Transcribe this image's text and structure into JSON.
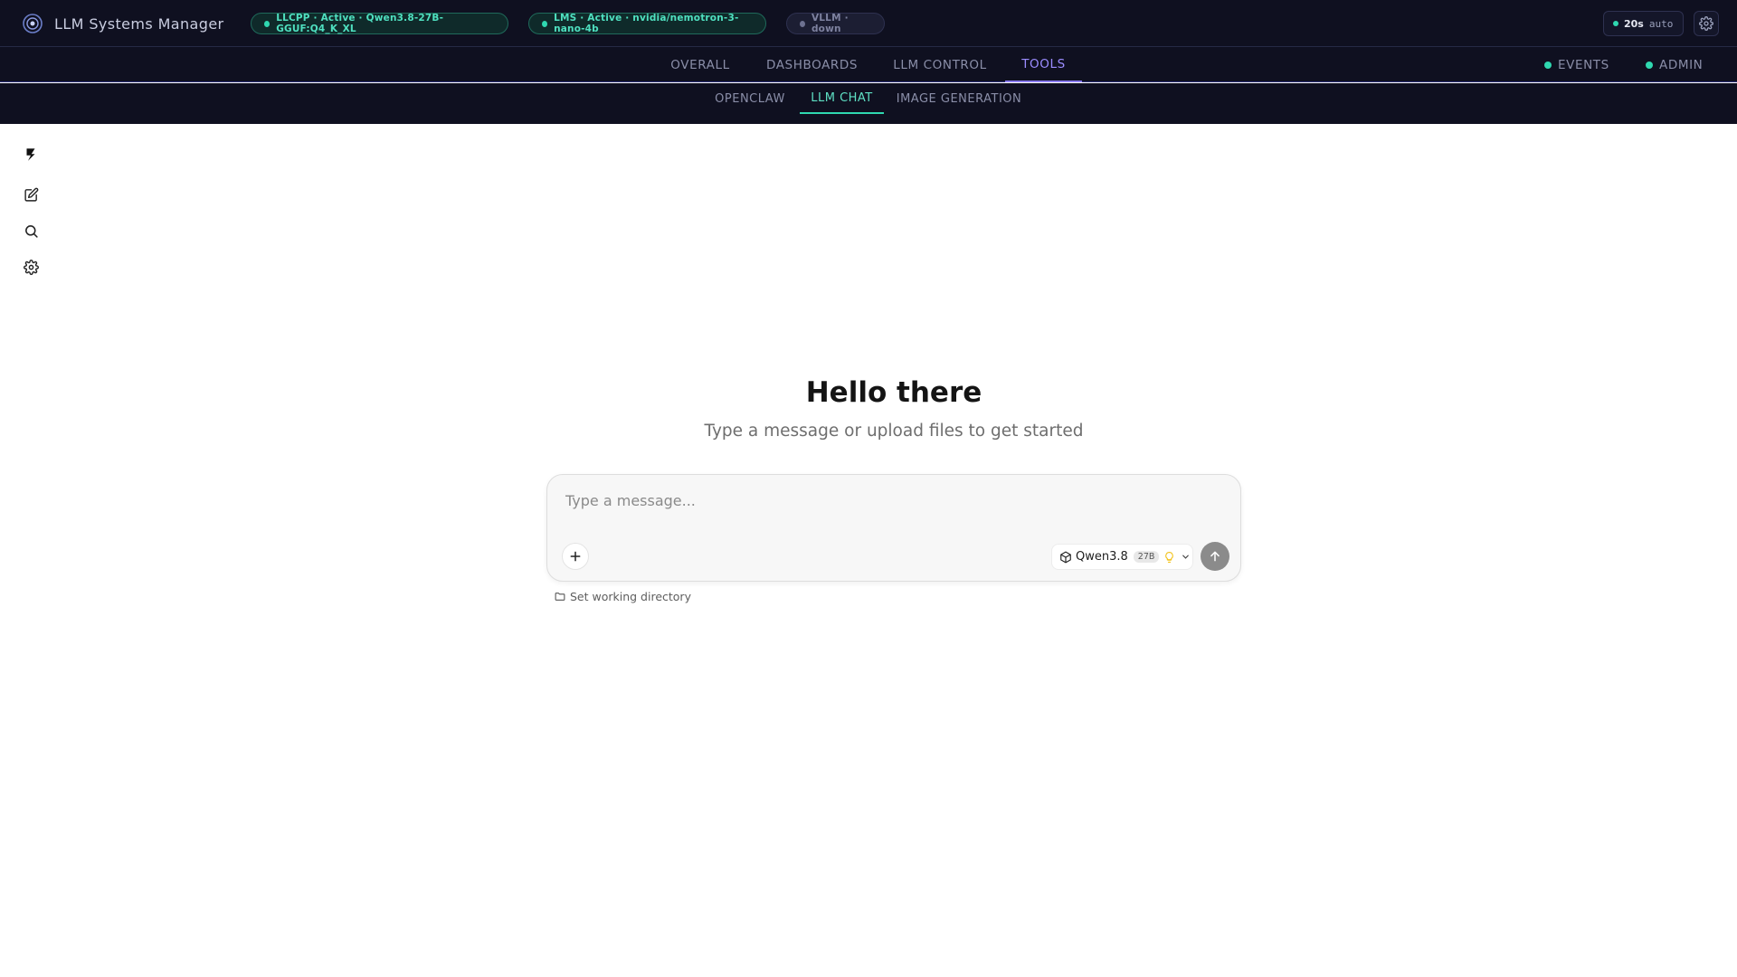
{
  "header": {
    "app_title": "LLM Systems Manager",
    "status_pills": [
      {
        "label": "LLCPP · Active · Qwen3.8-27B-GGUF:Q4_K_XL",
        "status": "active",
        "color": "#2fd8b0"
      },
      {
        "label": "LMS · Active · nvidia/nemotron-3-nano-4b",
        "status": "active",
        "color": "#2fd8b0"
      },
      {
        "label": "VLLM · down",
        "status": "down",
        "color": "#6d7190"
      }
    ],
    "refresh": {
      "interval": "20s",
      "mode": "auto"
    }
  },
  "main_nav": {
    "tabs": [
      {
        "label": "OVERALL"
      },
      {
        "label": "DASHBOARDS"
      },
      {
        "label": "LLM CONTROL"
      },
      {
        "label": "TOOLS",
        "active": true
      }
    ],
    "right": [
      {
        "label": "EVENTS"
      },
      {
        "label": "ADMIN"
      }
    ]
  },
  "sub_nav": {
    "tabs": [
      {
        "label": "OPENCLAW"
      },
      {
        "label": "LLM CHAT",
        "active": true
      },
      {
        "label": "IMAGE GENERATION"
      }
    ]
  },
  "sidebar": {
    "icons": [
      "logo-icon",
      "new-chat-icon",
      "search-icon",
      "settings-icon"
    ]
  },
  "chat": {
    "greeting": "Hello there",
    "subtitle": "Type a message or upload files to get started",
    "input_placeholder": "Type a message...",
    "model": {
      "name": "Qwen3.8",
      "size_badge": "27B"
    },
    "working_directory_label": "Set working directory"
  },
  "colors": {
    "header_bg": "#0f1020",
    "accent_purple": "#8b7cf7",
    "accent_teal": "#2fd8b0"
  }
}
